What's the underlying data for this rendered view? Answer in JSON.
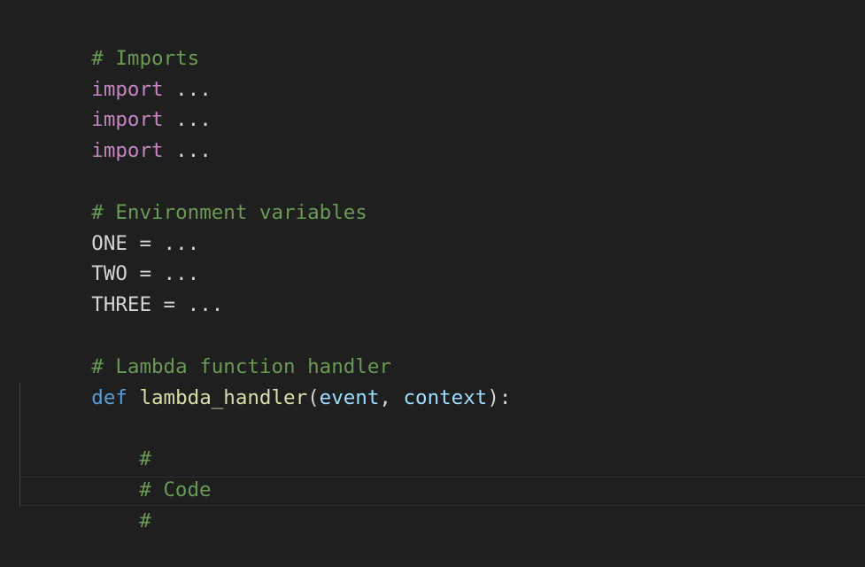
{
  "editor": {
    "lines": [
      {
        "comment": "# Imports"
      },
      {
        "keyword": "import",
        "rest": " ..."
      },
      {
        "keyword": "import",
        "rest": " ..."
      },
      {
        "keyword": "import",
        "rest": " ..."
      },
      {},
      {
        "comment": "# Environment variables"
      },
      {
        "text": "ONE = ..."
      },
      {
        "text": "TWO = ..."
      },
      {
        "text": "THREE = ..."
      },
      {},
      {
        "comment": "# Lambda function handler"
      },
      {
        "def": "def",
        "name": "lambda_handler",
        "open_paren": "(",
        "param1": "event",
        "comma": ", ",
        "param2": "context",
        "close": "):"
      },
      {},
      {
        "comment": "#"
      },
      {
        "comment": "# Code"
      },
      {
        "comment": "#"
      }
    ]
  },
  "colors": {
    "background": "#1f1f1f",
    "comment": "#6a9955",
    "keyword": "#c586c0",
    "storage": "#569cd6",
    "function": "#dcdcaa",
    "parameter": "#9cdcfe",
    "text": "#d4d4d4"
  }
}
